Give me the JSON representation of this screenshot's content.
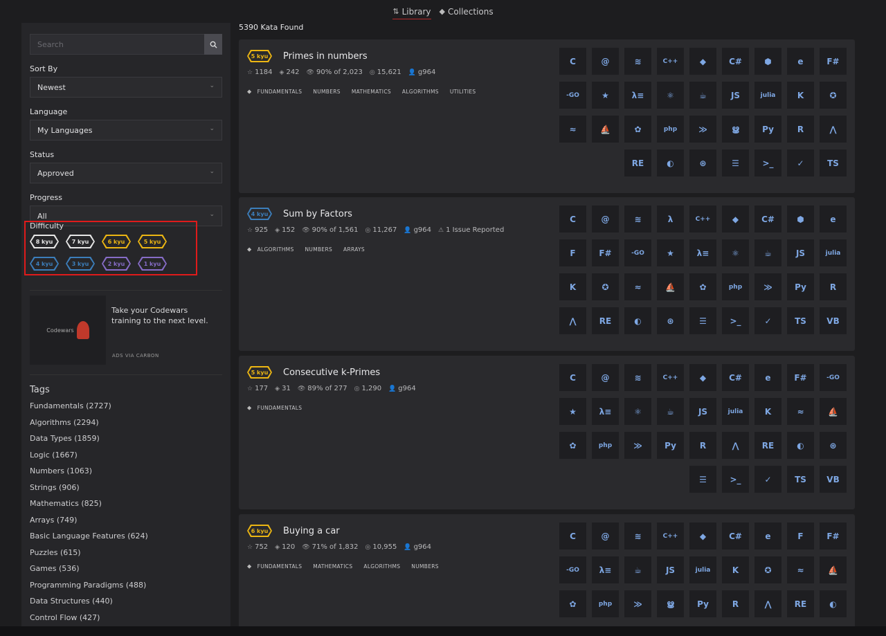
{
  "nav": {
    "tabs": [
      {
        "label": "Library",
        "icon": "library-icon",
        "active": true
      },
      {
        "label": "Collections",
        "icon": "collections-icon",
        "active": false
      }
    ]
  },
  "sidebar": {
    "search_placeholder": "Search",
    "sort_by": {
      "label": "Sort By",
      "value": "Newest"
    },
    "language": {
      "label": "Language",
      "value": "My Languages"
    },
    "status": {
      "label": "Status",
      "value": "Approved"
    },
    "progress": {
      "label": "Progress",
      "value": "All"
    },
    "difficulty": {
      "label": "Difficulty",
      "kyus": [
        {
          "label": "8 kyu",
          "color": "#e6e6e6"
        },
        {
          "label": "7 kyu",
          "color": "#e6e6e6"
        },
        {
          "label": "6 kyu",
          "color": "#ecb613"
        },
        {
          "label": "5 kyu",
          "color": "#ecb613"
        },
        {
          "label": "4 kyu",
          "color": "#3c7ebb"
        },
        {
          "label": "3 kyu",
          "color": "#3c7ebb"
        },
        {
          "label": "2 kyu",
          "color": "#866cc7"
        },
        {
          "label": "1 kyu",
          "color": "#866cc7"
        }
      ]
    },
    "ad": {
      "logo_text": "Codewars",
      "text": "Take your Codewars training to the next level.",
      "via": "ADS VIA CARBON"
    },
    "tags_title": "Tags",
    "tags": [
      "Fundamentals (2727)",
      "Algorithms (2294)",
      "Data Types (1859)",
      "Logic (1667)",
      "Numbers (1063)",
      "Strings (906)",
      "Mathematics (825)",
      "Arrays (749)",
      "Basic Language Features (624)",
      "Puzzles (615)",
      "Games (536)",
      "Programming Paradigms (488)",
      "Data Structures (440)",
      "Control Flow (427)"
    ]
  },
  "main": {
    "count": "5390 Kata Found",
    "katas": [
      {
        "rank": "5 kyu",
        "rank_color": "#ecb613",
        "title": "Primes in numbers",
        "stars": "1184",
        "collections": "242",
        "satisfaction": "90% of 2,023",
        "completions": "15,621",
        "author": "g964",
        "issues": "",
        "tags": [
          "FUNDAMENTALS",
          "NUMBERS",
          "MATHEMATICS",
          "ALGORITHMS",
          "UTILITIES"
        ],
        "langs": [
          "C",
          "@",
          "≋",
          "C++",
          "◆",
          "C#",
          "⬢",
          "e",
          "F#",
          "-GO",
          "★",
          "λ≡",
          "⚛",
          "☕",
          "JS",
          "julia",
          "K",
          "✪",
          "≈",
          "⛵",
          "✿",
          "php",
          "≫",
          "ൠ",
          "Py",
          "R",
          "⋀",
          "RE",
          "◐",
          "⊛",
          "☰",
          ">_",
          "✓",
          "TS"
        ]
      },
      {
        "rank": "4 kyu",
        "rank_color": "#3c7ebb",
        "title": "Sum by Factors",
        "stars": "925",
        "collections": "152",
        "satisfaction": "90% of 1,561",
        "completions": "11,267",
        "author": "g964",
        "issues": "1 Issue Reported",
        "tags": [
          "ALGORITHMS",
          "NUMBERS",
          "ARRAYS"
        ],
        "langs": [
          "C",
          "@",
          "≋",
          "λ",
          "C++",
          "◆",
          "C#",
          "⬢",
          "e",
          "F",
          "F#",
          "-GO",
          "★",
          "λ≡",
          "⚛",
          "☕",
          "JS",
          "julia",
          "K",
          "✪",
          "≈",
          "⛵",
          "✿",
          "php",
          "≫",
          "Py",
          "R",
          "⋀",
          "RE",
          "◐",
          "⊛",
          "☰",
          ">_",
          "✓",
          "TS",
          "VB"
        ]
      },
      {
        "rank": "5 kyu",
        "rank_color": "#ecb613",
        "title": "Consecutive k-Primes",
        "stars": "177",
        "collections": "31",
        "satisfaction": "89% of 277",
        "completions": "1,290",
        "author": "g964",
        "issues": "",
        "tags": [
          "FUNDAMENTALS"
        ],
        "langs": [
          "C",
          "@",
          "≋",
          "C++",
          "◆",
          "C#",
          "e",
          "F#",
          "-GO",
          "★",
          "λ≡",
          "⚛",
          "☕",
          "JS",
          "julia",
          "K",
          "≈",
          "⛵",
          "✿",
          "php",
          "≫",
          "Py",
          "R",
          "⋀",
          "RE",
          "◐",
          "⊛",
          "☰",
          ">_",
          "✓",
          "TS",
          "VB"
        ]
      },
      {
        "rank": "6 kyu",
        "rank_color": "#ecb613",
        "title": "Buying a car",
        "stars": "752",
        "collections": "120",
        "satisfaction": "71% of 1,832",
        "completions": "10,955",
        "author": "g964",
        "issues": "",
        "tags": [
          "FUNDAMENTALS",
          "MATHEMATICS",
          "ALGORITHMS",
          "NUMBERS"
        ],
        "langs": [
          "C",
          "@",
          "≋",
          "C++",
          "◆",
          "C#",
          "e",
          "F",
          "F#",
          "-GO",
          "λ≡",
          "☕",
          "JS",
          "julia",
          "K",
          "✪",
          "≈",
          "⛵",
          "✿",
          "php",
          "≫",
          "ൠ",
          "Py",
          "R",
          "⋀",
          "RE",
          "◐"
        ]
      }
    ]
  }
}
